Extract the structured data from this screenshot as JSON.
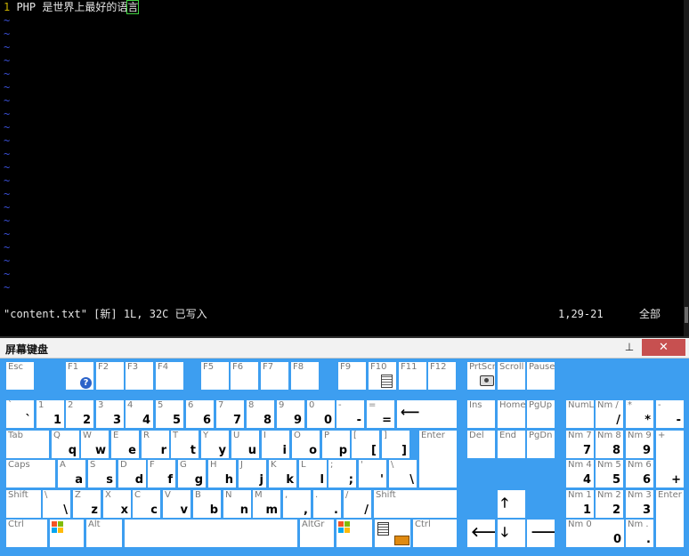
{
  "editor": {
    "line_number": "1",
    "line_text": " PHP 是世界上最好的语",
    "cursor_char": "言",
    "tilde": "~",
    "tilde_count": 21,
    "status_file": "\"content.txt\" [新] 1L, 32C 已写入",
    "status_pos": "1,29-21",
    "status_pct": "全部"
  },
  "osk": {
    "title": "屏幕键盘",
    "pin_icon": "pin-icon",
    "close_icon": "close-icon",
    "close_glyph": "✕",
    "colors": {
      "background": "#3d9ef0",
      "key": "#ffffff",
      "close": "#c75050"
    },
    "keys": {
      "esc": {
        "top": "Esc",
        "bot": ""
      },
      "f1": {
        "top": "F1",
        "bot": ""
      },
      "f2": {
        "top": "F2",
        "bot": ""
      },
      "f3": {
        "top": "F3",
        "bot": ""
      },
      "f4": {
        "top": "F4",
        "bot": ""
      },
      "f5": {
        "top": "F5",
        "bot": ""
      },
      "f6": {
        "top": "F6",
        "bot": ""
      },
      "f7": {
        "top": "F7",
        "bot": ""
      },
      "f8": {
        "top": "F8",
        "bot": ""
      },
      "f9": {
        "top": "F9",
        "bot": ""
      },
      "f10": {
        "top": "F10",
        "bot": ""
      },
      "f11": {
        "top": "F11",
        "bot": ""
      },
      "f12": {
        "top": "F12",
        "bot": ""
      },
      "prtsc": {
        "top": "PrtScn",
        "bot": ""
      },
      "scroll": {
        "top": "Scroll",
        "bot": ""
      },
      "pause": {
        "top": "Pause",
        "bot": ""
      },
      "grave": {
        "top": "`",
        "bot": "`"
      },
      "d1": {
        "top": "1",
        "bot": "1"
      },
      "d2": {
        "top": "2",
        "bot": "2"
      },
      "d3": {
        "top": "3",
        "bot": "3"
      },
      "d4": {
        "top": "4",
        "bot": "4"
      },
      "d5": {
        "top": "5",
        "bot": "5"
      },
      "d6": {
        "top": "6",
        "bot": "6"
      },
      "d7": {
        "top": "7",
        "bot": "7"
      },
      "d8": {
        "top": "8",
        "bot": "8"
      },
      "d9": {
        "top": "9",
        "bot": "9"
      },
      "d0": {
        "top": "0",
        "bot": "0"
      },
      "minus": {
        "top": "-",
        "bot": "-"
      },
      "equal": {
        "top": "=",
        "bot": "="
      },
      "back": {
        "top": "",
        "bot": "⟵"
      },
      "ins": {
        "top": "Ins",
        "bot": ""
      },
      "home": {
        "top": "Home",
        "bot": ""
      },
      "pgup": {
        "top": "PgUp",
        "bot": ""
      },
      "numl": {
        "top": "NumL",
        "bot": ""
      },
      "ndiv": {
        "top": "Nm /",
        "bot": "/"
      },
      "nmul": {
        "top": "*",
        "bot": "*"
      },
      "nsub": {
        "top": "-",
        "bot": "-"
      },
      "tab": {
        "top": "Tab",
        "bot": ""
      },
      "q": {
        "top": "Q",
        "bot": "q"
      },
      "w": {
        "top": "W",
        "bot": "w"
      },
      "e": {
        "top": "E",
        "bot": "e"
      },
      "r": {
        "top": "R",
        "bot": "r"
      },
      "t": {
        "top": "T",
        "bot": "t"
      },
      "y": {
        "top": "Y",
        "bot": "y"
      },
      "u": {
        "top": "U",
        "bot": "u"
      },
      "i": {
        "top": "I",
        "bot": "i"
      },
      "o": {
        "top": "O",
        "bot": "o"
      },
      "p": {
        "top": "P",
        "bot": "p"
      },
      "lbr": {
        "top": "[",
        "bot": "["
      },
      "rbr": {
        "top": "]",
        "bot": "]"
      },
      "enter": {
        "top": "Enter",
        "bot": ""
      },
      "del": {
        "top": "Del",
        "bot": ""
      },
      "end": {
        "top": "End",
        "bot": ""
      },
      "pgdn": {
        "top": "PgDn",
        "bot": ""
      },
      "n7": {
        "top": "Nm 7",
        "bot": "7"
      },
      "n8": {
        "top": "Nm 8",
        "bot": "8"
      },
      "n9": {
        "top": "Nm 9",
        "bot": "9"
      },
      "nadd": {
        "top": "+",
        "bot": "+"
      },
      "caps": {
        "top": "Caps",
        "bot": ""
      },
      "a": {
        "top": "A",
        "bot": "a"
      },
      "s": {
        "top": "S",
        "bot": "s"
      },
      "d": {
        "top": "D",
        "bot": "d"
      },
      "f": {
        "top": "F",
        "bot": "f"
      },
      "g": {
        "top": "G",
        "bot": "g"
      },
      "h": {
        "top": "H",
        "bot": "h"
      },
      "j": {
        "top": "J",
        "bot": "j"
      },
      "k": {
        "top": "K",
        "bot": "k"
      },
      "l": {
        "top": "L",
        "bot": "l"
      },
      "semi": {
        "top": ";",
        "bot": ";"
      },
      "quote": {
        "top": "'",
        "bot": "'"
      },
      "bslash": {
        "top": "\\",
        "bot": "\\"
      },
      "n4": {
        "top": "Nm 4",
        "bot": "4"
      },
      "n5": {
        "top": "Nm 5",
        "bot": "5"
      },
      "n6": {
        "top": "Nm 6",
        "bot": "6"
      },
      "lshift": {
        "top": "Shift",
        "bot": ""
      },
      "bslash2": {
        "top": "\\",
        "bot": "\\"
      },
      "z": {
        "top": "Z",
        "bot": "z"
      },
      "x": {
        "top": "X",
        "bot": "x"
      },
      "c": {
        "top": "C",
        "bot": "c"
      },
      "v": {
        "top": "V",
        "bot": "v"
      },
      "b": {
        "top": "B",
        "bot": "b"
      },
      "n": {
        "top": "N",
        "bot": "n"
      },
      "m": {
        "top": "M",
        "bot": "m"
      },
      "comma": {
        "top": ",",
        "bot": ","
      },
      "period": {
        "top": ".",
        "bot": "."
      },
      "slash": {
        "top": "/",
        "bot": "/"
      },
      "rshift": {
        "top": "Shift",
        "bot": ""
      },
      "up": {
        "top": "",
        "bot": "🡑"
      },
      "n1": {
        "top": "Nm 1",
        "bot": "1"
      },
      "n2": {
        "top": "Nm 2",
        "bot": "2"
      },
      "n3": {
        "top": "Nm 3",
        "bot": "3"
      },
      "nenter": {
        "top": "Enter",
        "bot": ""
      },
      "lctrl": {
        "top": "Ctrl",
        "bot": ""
      },
      "lwin": {
        "top": "",
        "bot": ""
      },
      "alt": {
        "top": "Alt",
        "bot": ""
      },
      "space": {
        "top": "",
        "bot": ""
      },
      "altgr": {
        "top": "AltGr",
        "bot": ""
      },
      "rwin": {
        "top": "",
        "bot": ""
      },
      "menu": {
        "top": "",
        "bot": ""
      },
      "rctrl": {
        "top": "Ctrl",
        "bot": ""
      },
      "left": {
        "top": "",
        "bot": "🡐"
      },
      "down": {
        "top": "",
        "bot": "🡓"
      },
      "right": {
        "top": "",
        "bot": "🡒"
      },
      "n0": {
        "top": "Nm 0",
        "bot": "0"
      },
      "ndot": {
        "top": "Nm .",
        "bot": "."
      }
    }
  }
}
